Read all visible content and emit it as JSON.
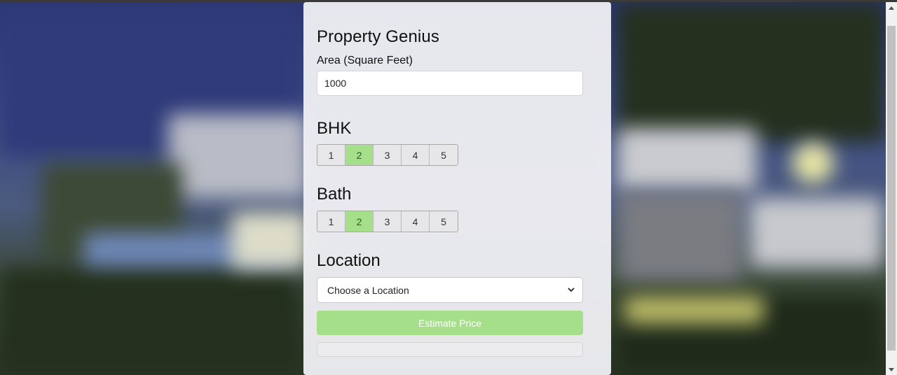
{
  "app": {
    "title": "Property Genius"
  },
  "area": {
    "label": "Area (Square Feet)",
    "value": "1000"
  },
  "bhk": {
    "title": "BHK",
    "options": [
      "1",
      "2",
      "3",
      "4",
      "5"
    ],
    "selected": "2"
  },
  "bath": {
    "title": "Bath",
    "options": [
      "1",
      "2",
      "3",
      "4",
      "5"
    ],
    "selected": "2"
  },
  "location": {
    "title": "Location",
    "selected": "Choose a Location"
  },
  "actions": {
    "estimate_label": "Estimate Price"
  },
  "result": {
    "text": ""
  },
  "colors": {
    "accent": "#a6df89",
    "card_bg": "#eeeef2"
  },
  "icons": {
    "dropdown": "chevron-down-icon",
    "scroll_up": "scroll-up-arrow-icon",
    "scroll_down": "scroll-down-arrow-icon"
  }
}
